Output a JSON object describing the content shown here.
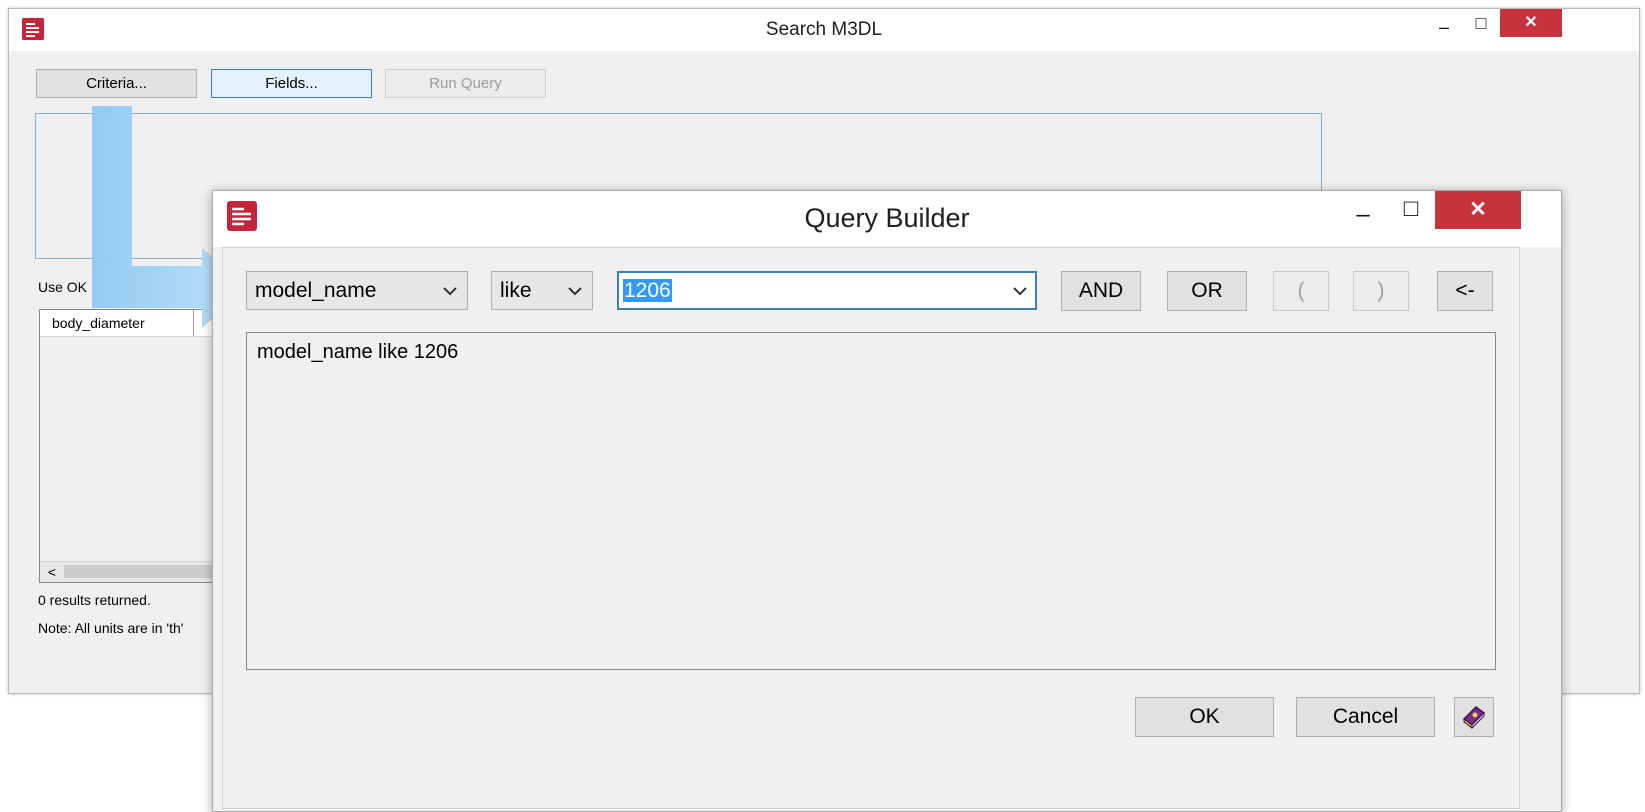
{
  "search_window": {
    "title": "Search M3DL",
    "criteria_button": "Criteria...",
    "fields_button": "Fields...",
    "run_query_button": "Run Query",
    "hint_text": "Use OK",
    "grid": {
      "columns": [
        "body_diameter"
      ],
      "scroll_left": "<"
    },
    "results_text": "0 results returned.",
    "note_text": "Note: All units are in 'th'"
  },
  "query_builder": {
    "title": "Query Builder",
    "field_select": "model_name",
    "operator_select": "like",
    "value_input": "1206",
    "and_button": "AND",
    "or_button": "OR",
    "open_paren_button": "(",
    "close_paren_button": ")",
    "backspace_button": "<-",
    "expression": "model_name like 1206",
    "ok_button": "OK",
    "cancel_button": "Cancel",
    "help_icon": "help-book-icon"
  },
  "caption_buttons": {
    "minimize": "–",
    "maximize": "□",
    "close": "✕"
  },
  "colors": {
    "close_red": "#c7333d",
    "app_icon_red": "#c3263a",
    "arrow_blue": "#8ec9f2",
    "selection_blue": "#3399ff",
    "focus_border": "#3c7fb1"
  }
}
